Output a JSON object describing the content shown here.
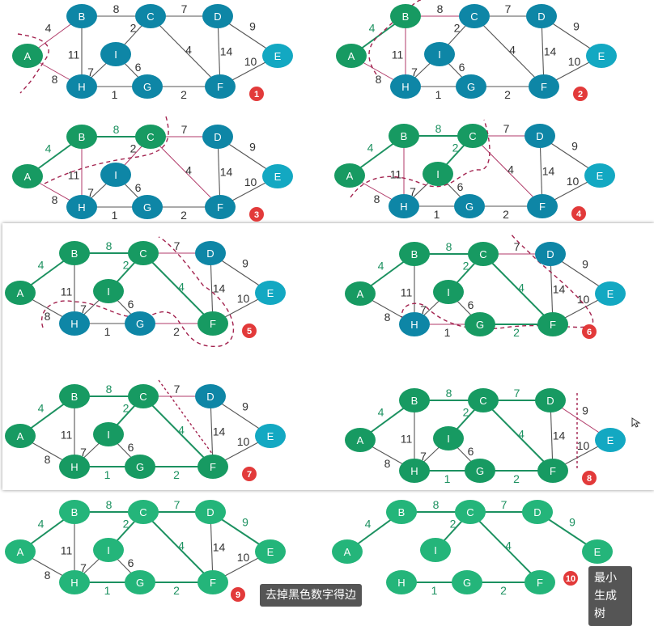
{
  "colors": {
    "teal": "#0e86a6",
    "cyan": "#13a8c2",
    "green": "#179a62",
    "light_green": "#24b57a",
    "tree_edge": "#1c9160",
    "graph_edge": "#555555",
    "candidate_edge": "#b03a68",
    "cut": "#a3234f",
    "badge": "#e23a3a",
    "tooltip_bg": "#555555"
  },
  "graph": {
    "nodes": [
      "A",
      "B",
      "C",
      "D",
      "E",
      "F",
      "G",
      "H",
      "I"
    ],
    "edges": [
      {
        "u": "A",
        "v": "B",
        "w": "4"
      },
      {
        "u": "A",
        "v": "H",
        "w": "8"
      },
      {
        "u": "B",
        "v": "C",
        "w": "8"
      },
      {
        "u": "B",
        "v": "H",
        "w": "11"
      },
      {
        "u": "C",
        "v": "D",
        "w": "7"
      },
      {
        "u": "C",
        "v": "I",
        "w": "2"
      },
      {
        "u": "C",
        "v": "F",
        "w": "4"
      },
      {
        "u": "D",
        "v": "F",
        "w": "14"
      },
      {
        "u": "D",
        "v": "E",
        "w": "9"
      },
      {
        "u": "E",
        "v": "F",
        "w": "10"
      },
      {
        "u": "F",
        "v": "G",
        "w": "2"
      },
      {
        "u": "G",
        "v": "H",
        "w": "1"
      },
      {
        "u": "G",
        "v": "I",
        "w": "6"
      },
      {
        "u": "H",
        "v": "I",
        "w": "7"
      }
    ]
  },
  "panels": [
    {
      "badge": "1",
      "tree": [],
      "in": [
        "A"
      ],
      "candidates": [
        "AB",
        "AH"
      ],
      "cut": true
    },
    {
      "badge": "2",
      "tree": [
        "AB"
      ],
      "in": [
        "A",
        "B"
      ],
      "candidates": [
        "BC",
        "BH",
        "AH"
      ],
      "cut": true
    },
    {
      "badge": "3",
      "tree": [
        "AB",
        "BC"
      ],
      "in": [
        "A",
        "B",
        "C"
      ],
      "candidates": [
        "CI",
        "CF",
        "CD",
        "BH",
        "AH"
      ],
      "cut": true
    },
    {
      "badge": "4",
      "tree": [
        "AB",
        "BC",
        "CI"
      ],
      "in": [
        "A",
        "B",
        "C",
        "I"
      ],
      "candidates": [
        "CF",
        "CD",
        "IH",
        "IG",
        "AH",
        "BH"
      ],
      "cut": true
    },
    {
      "badge": "5",
      "tree": [
        "AB",
        "BC",
        "CI",
        "CF"
      ],
      "in": [
        "A",
        "B",
        "C",
        "I",
        "F"
      ],
      "candidates": [
        "FG",
        "FE",
        "FD",
        "CD",
        "IG",
        "IH"
      ],
      "cut": true
    },
    {
      "badge": "6",
      "tree": [
        "AB",
        "BC",
        "CI",
        "CF",
        "FG"
      ],
      "in": [
        "A",
        "B",
        "C",
        "I",
        "F",
        "G"
      ],
      "candidates": [
        "GH",
        "IH",
        "FE",
        "FD",
        "CD"
      ],
      "cut": true
    },
    {
      "badge": "7",
      "tree": [
        "AB",
        "BC",
        "CI",
        "CF",
        "FG",
        "GH"
      ],
      "in": [
        "A",
        "B",
        "C",
        "I",
        "F",
        "G",
        "H"
      ],
      "candidates": [
        "CD",
        "FD",
        "FE"
      ],
      "cut": true
    },
    {
      "badge": "8",
      "tree": [
        "AB",
        "BC",
        "CI",
        "CF",
        "FG",
        "GH",
        "CD"
      ],
      "in": [
        "A",
        "B",
        "C",
        "I",
        "F",
        "G",
        "H",
        "D"
      ],
      "candidates": [
        "DE",
        "FE"
      ],
      "cut": true
    },
    {
      "badge": "9",
      "tree": [
        "AB",
        "BC",
        "CI",
        "CF",
        "FG",
        "GH",
        "CD",
        "DE"
      ],
      "in": [
        "A",
        "B",
        "C",
        "D",
        "E",
        "F",
        "G",
        "H",
        "I"
      ],
      "candidates": [],
      "cut": false
    },
    {
      "badge": "10",
      "tree": [
        "AB",
        "BC",
        "CI",
        "CF",
        "FG",
        "GH",
        "CD",
        "DE"
      ],
      "in": [
        "A",
        "B",
        "C",
        "D",
        "E",
        "F",
        "G",
        "H",
        "I"
      ],
      "candidates": [],
      "cut": false,
      "final": true
    }
  ],
  "tooltips": {
    "step9": "去掉黑色数字得边",
    "step10": "最小生成树"
  }
}
